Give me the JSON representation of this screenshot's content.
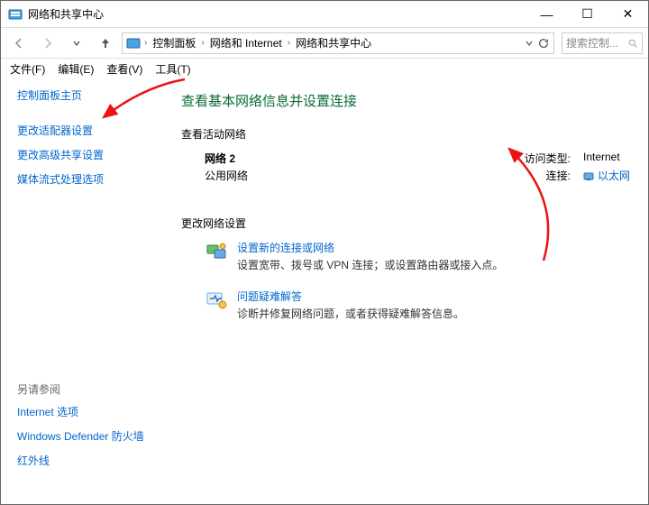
{
  "title": "网络和共享中心",
  "window_controls": {
    "min": "—",
    "max": "☐",
    "close": "✕"
  },
  "nav": {
    "breadcrumbs": [
      "控制面板",
      "网络和 Internet",
      "网络和共享中心"
    ],
    "search_placeholder": "搜索控制...",
    "refresh_icon": "refresh"
  },
  "menus": [
    "文件(F)",
    "编辑(E)",
    "查看(V)",
    "工具(T)"
  ],
  "sidebar": {
    "home": "控制面板主页",
    "items": [
      "更改适配器设置",
      "更改高级共享设置",
      "媒体流式处理选项"
    ],
    "see_also_label": "另请参阅",
    "see_also": [
      "Internet 选项",
      "Windows Defender 防火墙",
      "红外线"
    ]
  },
  "main": {
    "heading": "查看基本网络信息并设置连接",
    "active_networks_label": "查看活动网络",
    "network": {
      "name": "网络 2",
      "category": "公用网络",
      "access_type_label": "访问类型:",
      "access_type_value": "Internet",
      "connection_label": "连接:",
      "connection_value": "以太网"
    },
    "change_settings_label": "更改网络设置",
    "tasks": [
      {
        "icon": "network-wizard",
        "title": "设置新的连接或网络",
        "desc": "设置宽带、拨号或 VPN 连接；或设置路由器或接入点。"
      },
      {
        "icon": "troubleshoot",
        "title": "问题疑难解答",
        "desc": "诊断并修复网络问题，或者获得疑难解答信息。"
      }
    ]
  }
}
